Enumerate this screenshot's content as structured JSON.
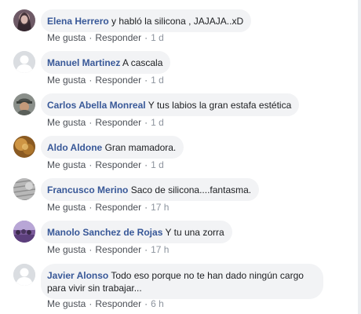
{
  "actions": {
    "like_label": "Me gusta",
    "reply_label": "Responder",
    "separator": "·"
  },
  "comments": [
    {
      "author": "Elena Herrero",
      "text": "y habló la silicona , JAJAJA..xD",
      "time": "1 d",
      "avatar": "photo-woman-dark-hair"
    },
    {
      "author": "Manuel Martinez",
      "text": "A cascala",
      "time": "1 d",
      "avatar": "default-profile-silhouette"
    },
    {
      "author": "Carlos Abella Monreal",
      "text": "Y tus labios la gran estafa estética",
      "time": "1 d",
      "avatar": "photo-man-cap"
    },
    {
      "author": "Aldo Aldone",
      "text": "Gran mamadora.",
      "time": "1 d",
      "avatar": "photo-golden-blurred"
    },
    {
      "author": "Francusco Merino",
      "text": "Saco de silicona....fantasma.",
      "time": "17 h",
      "avatar": "photo-gray-pattern"
    },
    {
      "author": "Manolo Sanchez de Rojas",
      "text": "Y tu una zorra",
      "time": "17 h",
      "avatar": "photo-purple-crowd"
    },
    {
      "author": "Javier Alonso",
      "text": "Todo eso porque no te han dado ningún cargo para vivir sin trabajar...",
      "time": "6 h",
      "avatar": "default-profile-silhouette"
    }
  ]
}
